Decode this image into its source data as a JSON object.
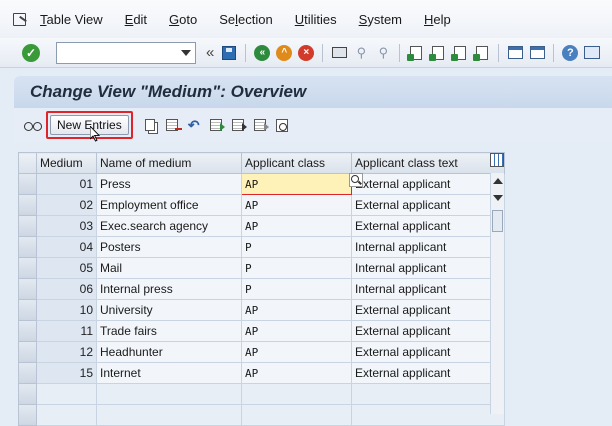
{
  "menu": {
    "items": [
      {
        "label": "Table View",
        "u": "T",
        "rest": "able View"
      },
      {
        "label": "Edit",
        "u": "E",
        "rest": "dit"
      },
      {
        "label": "Goto",
        "u": "G",
        "rest": "oto"
      },
      {
        "label": "Selection",
        "pre": "Se",
        "u": "l",
        "rest": "ection"
      },
      {
        "label": "Utilities",
        "u": "U",
        "rest": "tilities"
      },
      {
        "label": "System",
        "u": "S",
        "rest": "ystem"
      },
      {
        "label": "Help",
        "u": "H",
        "rest": "elp"
      }
    ]
  },
  "toolbar": {
    "command_value": ""
  },
  "title": "Change View \"Medium\": Overview",
  "app_toolbar": {
    "new_entries_label": "New Entries"
  },
  "table": {
    "columns": [
      "Medium",
      "Name of medium",
      "Applicant class",
      "Applicant class text"
    ],
    "rows": [
      {
        "medium": "01",
        "name": "Press",
        "class": "AP",
        "text": "External applicant"
      },
      {
        "medium": "02",
        "name": "Employment office",
        "class": "AP",
        "text": "External applicant"
      },
      {
        "medium": "03",
        "name": "Exec.search agency",
        "class": "AP",
        "text": "External applicant"
      },
      {
        "medium": "04",
        "name": "Posters",
        "class": "P",
        "text": "Internal applicant"
      },
      {
        "medium": "05",
        "name": "Mail",
        "class": "P",
        "text": "Internal applicant"
      },
      {
        "medium": "06",
        "name": "Internal press",
        "class": "P",
        "text": "Internal applicant"
      },
      {
        "medium": "10",
        "name": "University",
        "class": "AP",
        "text": "External applicant"
      },
      {
        "medium": "11",
        "name": "Trade fairs",
        "class": "AP",
        "text": "External applicant"
      },
      {
        "medium": "12",
        "name": "Headhunter",
        "class": "AP",
        "text": "External applicant"
      },
      {
        "medium": "15",
        "name": "Internet",
        "class": "AP",
        "text": "External applicant"
      }
    ]
  },
  "colors": {
    "title_bg": "#c8d8ec",
    "highlight_border": "#e0252a",
    "focus_cell": "#fff2b8"
  }
}
